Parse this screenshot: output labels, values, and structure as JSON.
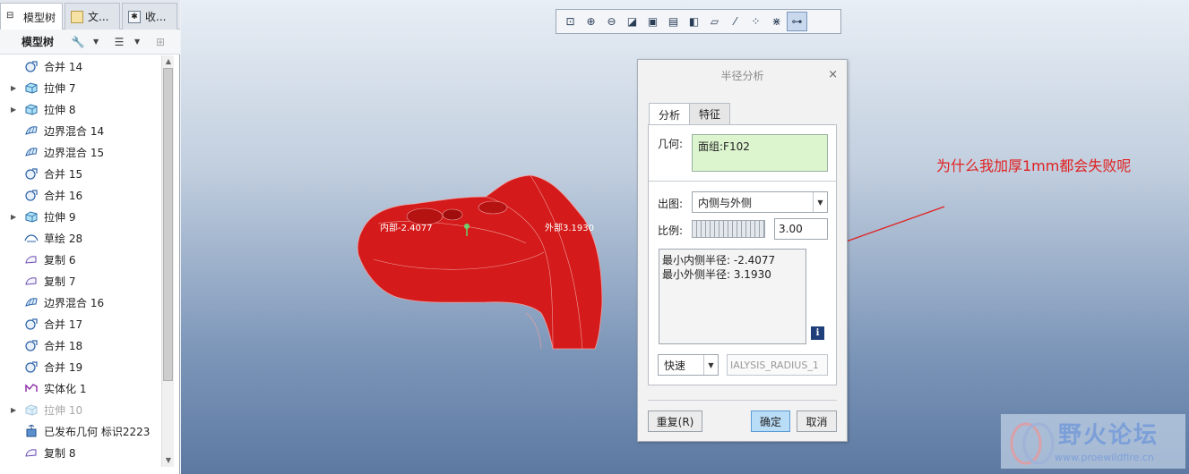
{
  "left_panel": {
    "tabs": [
      {
        "label": "模型树"
      },
      {
        "label": "文..."
      },
      {
        "label": "收..."
      }
    ],
    "toolbar_label": "模型树",
    "tree_items": [
      {
        "label": "合并 14",
        "icon": "merge-icon",
        "expandable": false
      },
      {
        "label": "拉伸 7",
        "icon": "extrude-icon",
        "expandable": true
      },
      {
        "label": "拉伸 8",
        "icon": "extrude-icon",
        "expandable": true
      },
      {
        "label": "边界混合 14",
        "icon": "boundary-blend-icon",
        "expandable": false
      },
      {
        "label": "边界混合 15",
        "icon": "boundary-blend-icon",
        "expandable": false
      },
      {
        "label": "合并 15",
        "icon": "merge-icon",
        "expandable": false
      },
      {
        "label": "合并 16",
        "icon": "merge-icon",
        "expandable": false
      },
      {
        "label": "拉伸 9",
        "icon": "extrude-icon",
        "expandable": true
      },
      {
        "label": "草绘 28",
        "icon": "sketch-icon",
        "expandable": false
      },
      {
        "label": "复制 6",
        "icon": "copy-icon",
        "expandable": false
      },
      {
        "label": "复制 7",
        "icon": "copy-icon",
        "expandable": false
      },
      {
        "label": "边界混合 16",
        "icon": "boundary-blend-icon",
        "expandable": false
      },
      {
        "label": "合并 17",
        "icon": "merge-icon",
        "expandable": false
      },
      {
        "label": "合并 18",
        "icon": "merge-icon",
        "expandable": false
      },
      {
        "label": "合并 19",
        "icon": "merge-icon",
        "expandable": false
      },
      {
        "label": "实体化 1",
        "icon": "solidify-icon",
        "expandable": false
      },
      {
        "label": "拉伸 10",
        "icon": "extrude-icon",
        "expandable": true,
        "disabled": true
      },
      {
        "label": "已发布几何 标识2223",
        "icon": "published-geometry-icon",
        "expandable": false
      },
      {
        "label": "复制 8",
        "icon": "copy-icon",
        "expandable": false
      }
    ]
  },
  "viewport": {
    "model_labels": {
      "inner": "内部-2.4077",
      "outer": "外部3.1930"
    },
    "annotation": "为什么我加厚1mm都会失败呢",
    "annotation_color": "#e02020"
  },
  "dialog": {
    "title": "半径分析",
    "close_glyph": "×",
    "tabs": [
      "分析",
      "特征"
    ],
    "geometry_label": "几何:",
    "geometry_value": "面组:F102",
    "plot_label": "出图:",
    "plot_value": "内侧与外侧",
    "scale_label": "比例:",
    "scale_value": "3.00",
    "results": [
      "最小内侧半径: -2.4077",
      "最小外侧半径: 3.1930"
    ],
    "info_glyph": "i",
    "speed_value": "快速",
    "feature_name": "IALYSIS_RADIUS_1",
    "buttons": {
      "repeat": "重复(R)",
      "ok": "确定",
      "cancel": "取消"
    }
  },
  "watermark": {
    "title": "野火论坛",
    "url": "www.proewildfire.cn"
  }
}
